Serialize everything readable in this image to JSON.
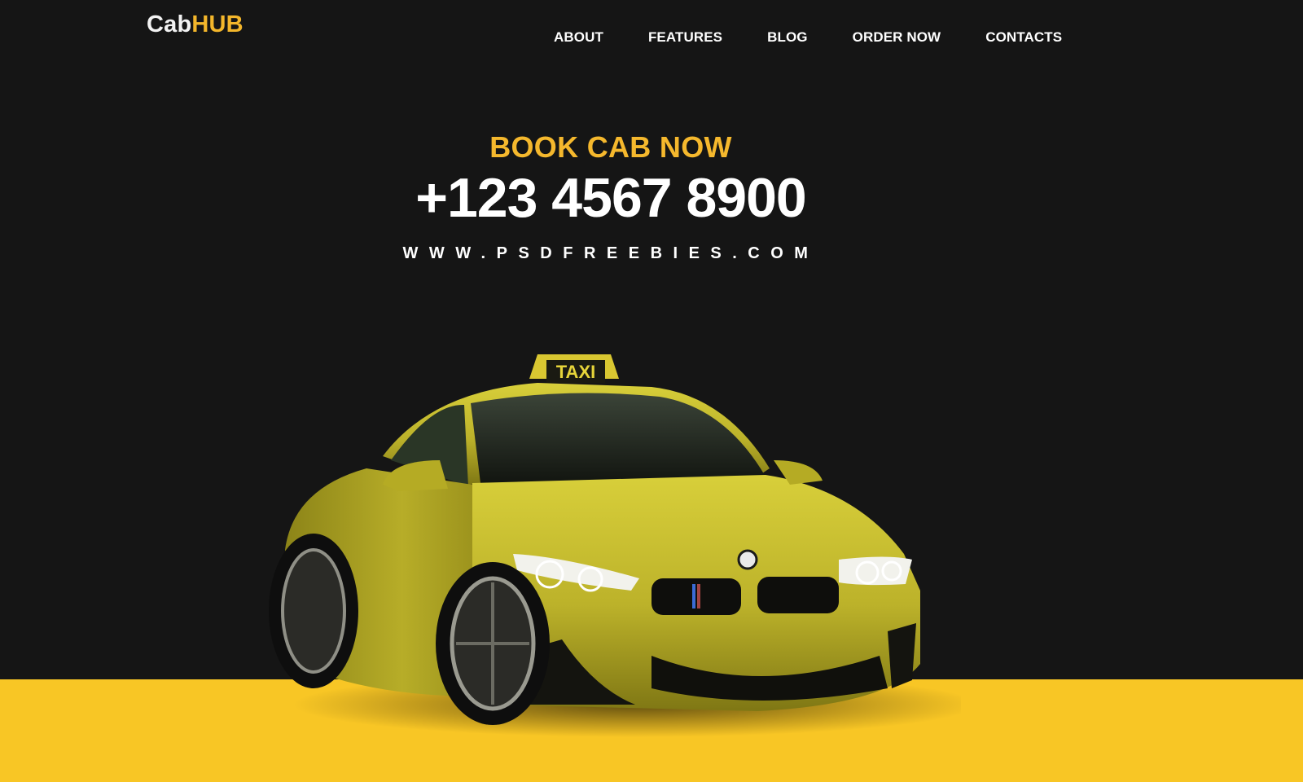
{
  "brand": {
    "part1": "Cab",
    "part2": "HUB"
  },
  "nav": {
    "items": [
      {
        "label": "ABOUT"
      },
      {
        "label": "FEATURES"
      },
      {
        "label": "BLOG"
      },
      {
        "label": "ORDER NOW"
      },
      {
        "label": "CONTACTS"
      }
    ]
  },
  "hero": {
    "kicker": "BOOK CAB NOW",
    "phone": "+123 4567 8900",
    "url": "WWW.PSDFREEBIES.COM",
    "car_sign": "TAXI"
  },
  "colors": {
    "background": "#151515",
    "accent": "#f5b82d",
    "band": "#f8c625",
    "text": "#ffffff"
  }
}
